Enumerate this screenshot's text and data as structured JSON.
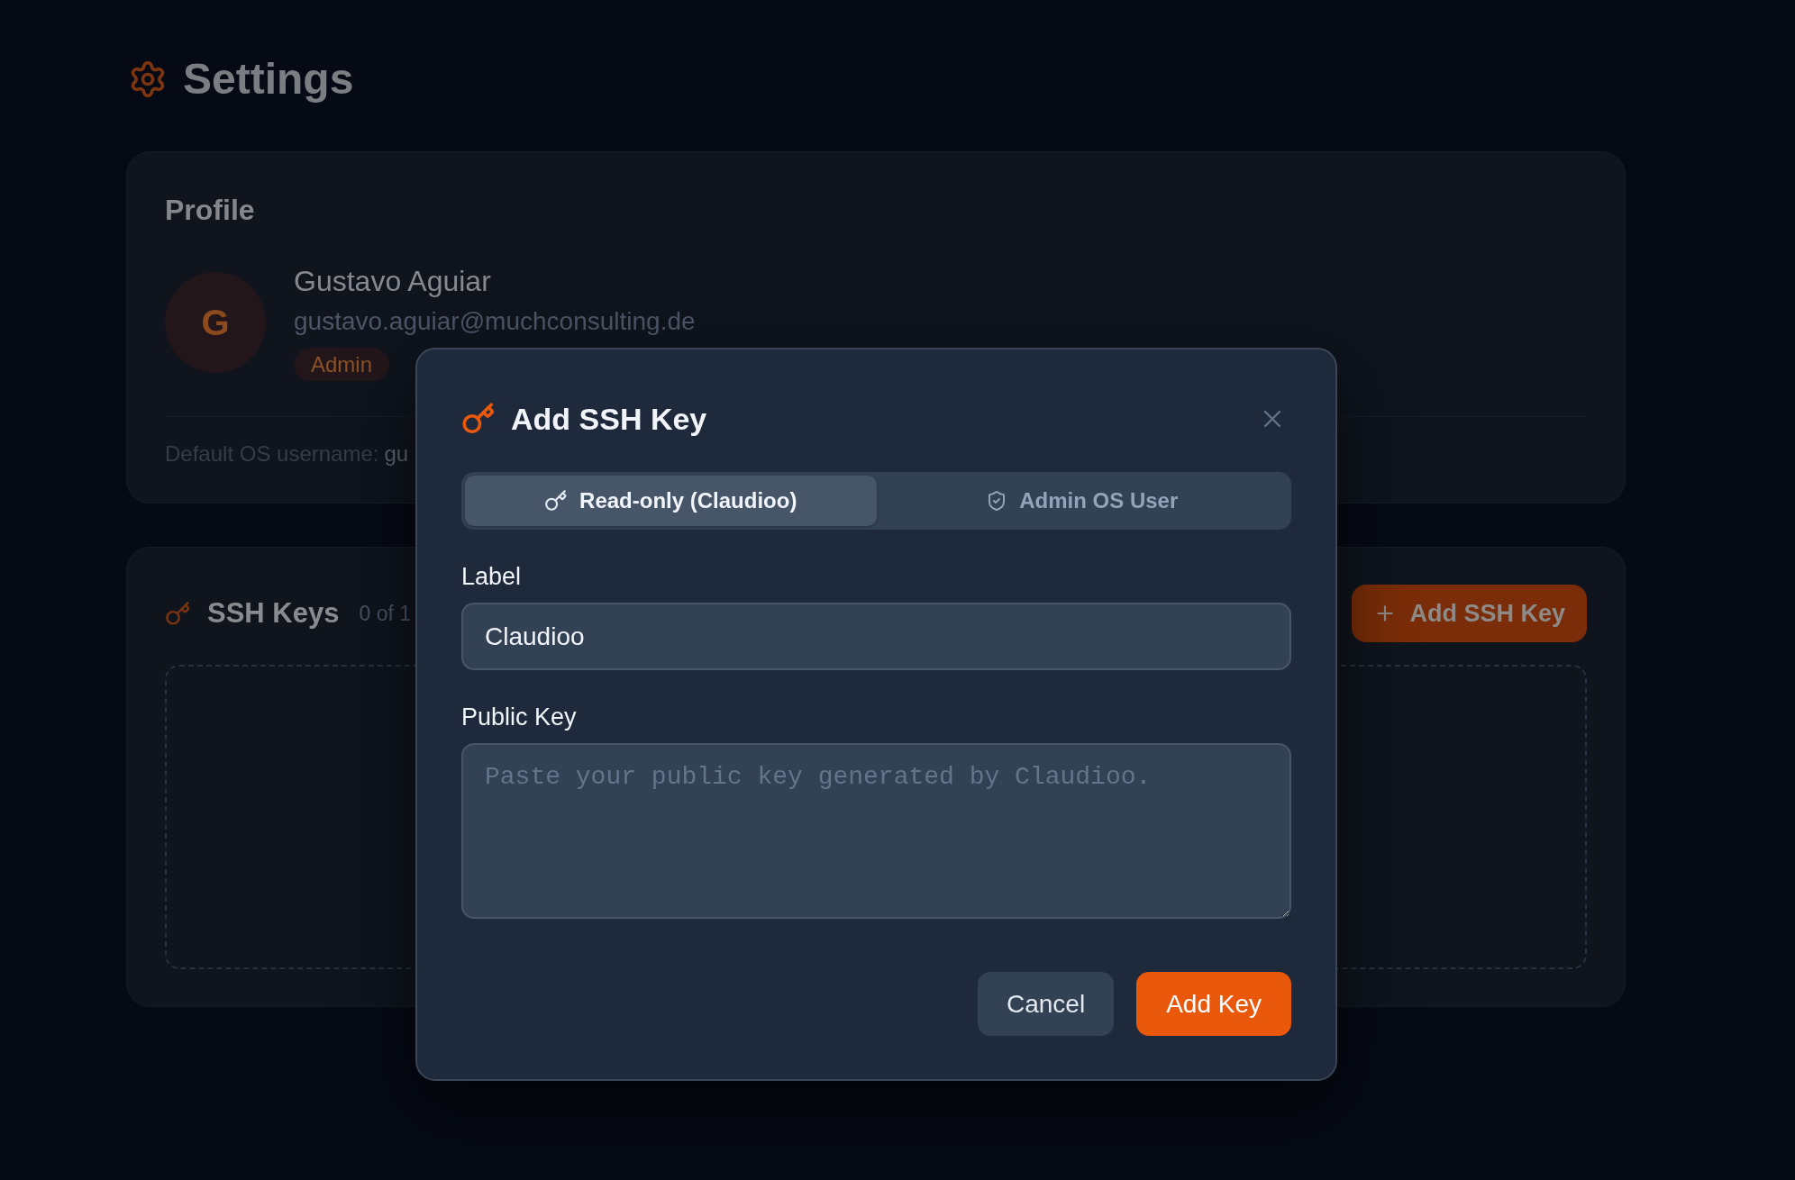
{
  "page": {
    "title": "Settings"
  },
  "profile": {
    "heading": "Profile",
    "avatar_initial": "G",
    "name": "Gustavo Aguiar",
    "email": "gustavo.aguiar@muchconsulting.de",
    "role_badge": "Admin",
    "os_username_label": "Default OS username:",
    "os_username": "gu"
  },
  "ssh_keys": {
    "heading": "SSH Keys",
    "count": "0 of 1",
    "add_button": "Add SSH Key"
  },
  "dialog": {
    "title": "Add SSH Key",
    "tabs": [
      {
        "label": "Read-only (Claudioo)",
        "selected": true
      },
      {
        "label": "Admin OS User",
        "selected": false
      }
    ],
    "fields": [
      {
        "kind": "input",
        "label": "Label",
        "value": "Claudioo"
      },
      {
        "kind": "textarea",
        "label": "Public Key",
        "placeholder": "Paste your public key generated by Claudioo."
      }
    ],
    "buttons": [
      {
        "kind": "secondary",
        "label": "Cancel"
      },
      {
        "kind": "primary",
        "label": "Add Key"
      }
    ]
  }
}
